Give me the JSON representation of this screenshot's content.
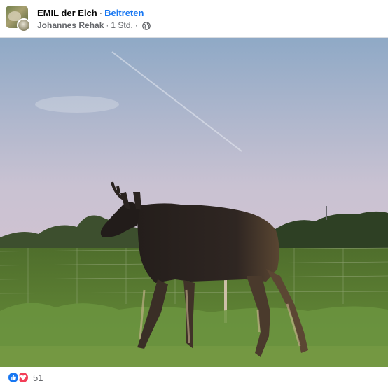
{
  "post": {
    "group_name": "EMIL der Elch",
    "separator": "·",
    "join_label": "Beitreten",
    "author": "Johannes Rehak",
    "time": "1 Std.",
    "audience_icon": "globe-icon"
  },
  "media": {
    "type": "video-frame",
    "colors": {
      "sky_top": "#8fa9c6",
      "sky_mid": "#c9c2d2",
      "sky_bottom": "#dcc4cf",
      "grass": "#5c7f33",
      "moose": "#2a2320"
    }
  },
  "reactions": {
    "icons": [
      "like-icon",
      "love-icon"
    ],
    "count": "51",
    "colors": {
      "like": "#1877f2",
      "love": "#f33e58"
    }
  }
}
